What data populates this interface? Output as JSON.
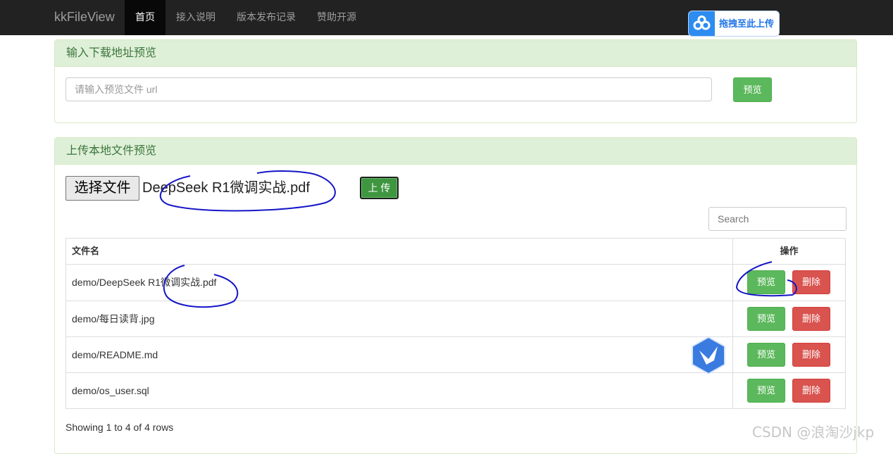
{
  "navbar": {
    "brand": "kkFileView",
    "items": [
      {
        "label": "首页",
        "active": true
      },
      {
        "label": "接入说明",
        "active": false
      },
      {
        "label": "版本发布记录",
        "active": false
      },
      {
        "label": "赞助开源",
        "active": false
      }
    ],
    "float_upload_label": "拖拽至此上传"
  },
  "url_panel": {
    "heading": "输入下载地址预览",
    "input_placeholder": "请输入预览文件 url",
    "preview_button": "预览"
  },
  "upload_panel": {
    "heading": "上传本地文件预览",
    "choose_file_button": "选择文件",
    "chosen_file": "DeepSeek R1微调实战.pdf",
    "upload_button": "上 传",
    "search_placeholder": "Search",
    "table": {
      "columns": [
        "文件名",
        "操作"
      ],
      "rows": [
        {
          "name": "demo/DeepSeek R1微调实战.pdf",
          "preview": "预览",
          "delete": "删除"
        },
        {
          "name": "demo/每日读背.jpg",
          "preview": "预览",
          "delete": "删除"
        },
        {
          "name": "demo/README.md",
          "preview": "预览",
          "delete": "删除"
        },
        {
          "name": "demo/os_user.sql",
          "preview": "预览",
          "delete": "删除"
        }
      ]
    },
    "pagination_info": "Showing 1 to 4 of 4 rows"
  },
  "watermark": "CSDN @浪淘沙jkp",
  "colors": {
    "navbar": "#222222",
    "panel_heading": "#dff0d8",
    "success": "#5cb85c",
    "danger": "#d9534f",
    "annotation_ink": "#1515c8"
  }
}
